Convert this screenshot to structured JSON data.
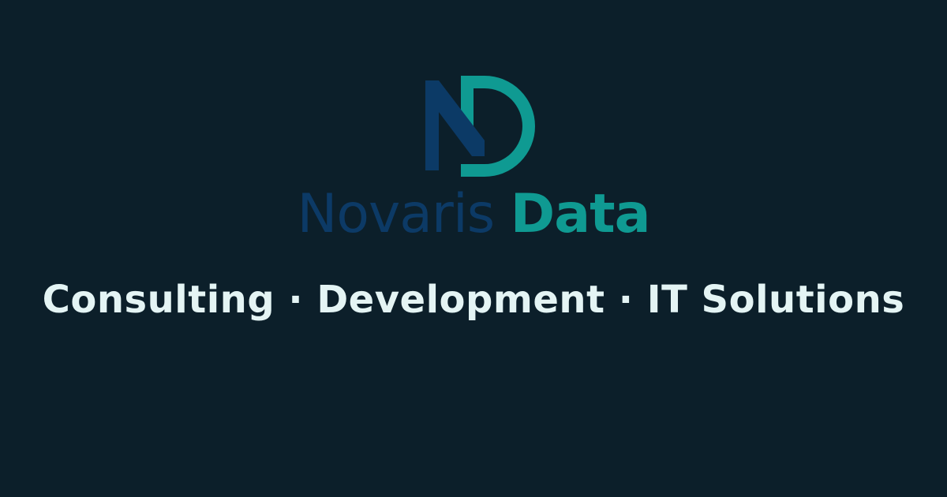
{
  "brand": {
    "name_primary": "Novaris",
    "name_secondary": "Data",
    "colors": {
      "navy": "#0c3a66",
      "teal": "#0f9a92",
      "background": "#0c1f2a"
    },
    "logo_icon": "nd-monogram-icon"
  },
  "tagline": {
    "text": "Consulting · Development · IT Solutions",
    "color": "#e4f4f4"
  }
}
